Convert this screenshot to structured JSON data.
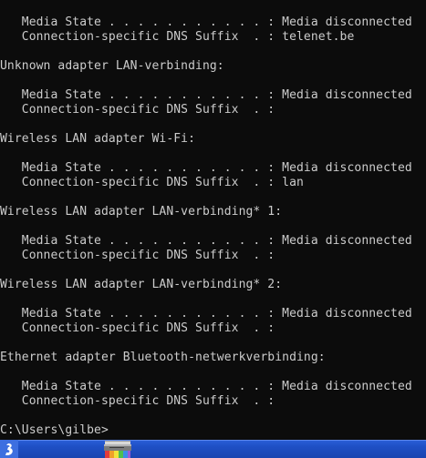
{
  "console": {
    "lines": [
      "   Media State . . . . . . . . . . . : Media disconnected",
      "   Connection-specific DNS Suffix  . : telenet.be",
      "",
      "Unknown adapter LAN-verbinding:",
      "",
      "   Media State . . . . . . . . . . . : Media disconnected",
      "   Connection-specific DNS Suffix  . :",
      "",
      "Wireless LAN adapter Wi-Fi:",
      "",
      "   Media State . . . . . . . . . . . : Media disconnected",
      "   Connection-specific DNS Suffix  . : lan",
      "",
      "Wireless LAN adapter LAN-verbinding* 1:",
      "",
      "   Media State . . . . . . . . . . . : Media disconnected",
      "   Connection-specific DNS Suffix  . :",
      "",
      "Wireless LAN adapter LAN-verbinding* 2:",
      "",
      "   Media State . . . . . . . . . . . : Media disconnected",
      "   Connection-specific DNS Suffix  . :",
      "",
      "Ethernet adapter Bluetooth-netwerkverbinding:",
      "",
      "   Media State . . . . . . . . . . . : Media disconnected",
      "   Connection-specific DNS Suffix  . :",
      "",
      "C:\\Users\\gilbe>"
    ]
  },
  "taskbar": {
    "icons": [
      "app-icon",
      "printer-icon"
    ]
  },
  "colors": {
    "console_background": "#0c0c0c",
    "console_text": "#cccccc",
    "taskbar": "#1e4fc4"
  }
}
